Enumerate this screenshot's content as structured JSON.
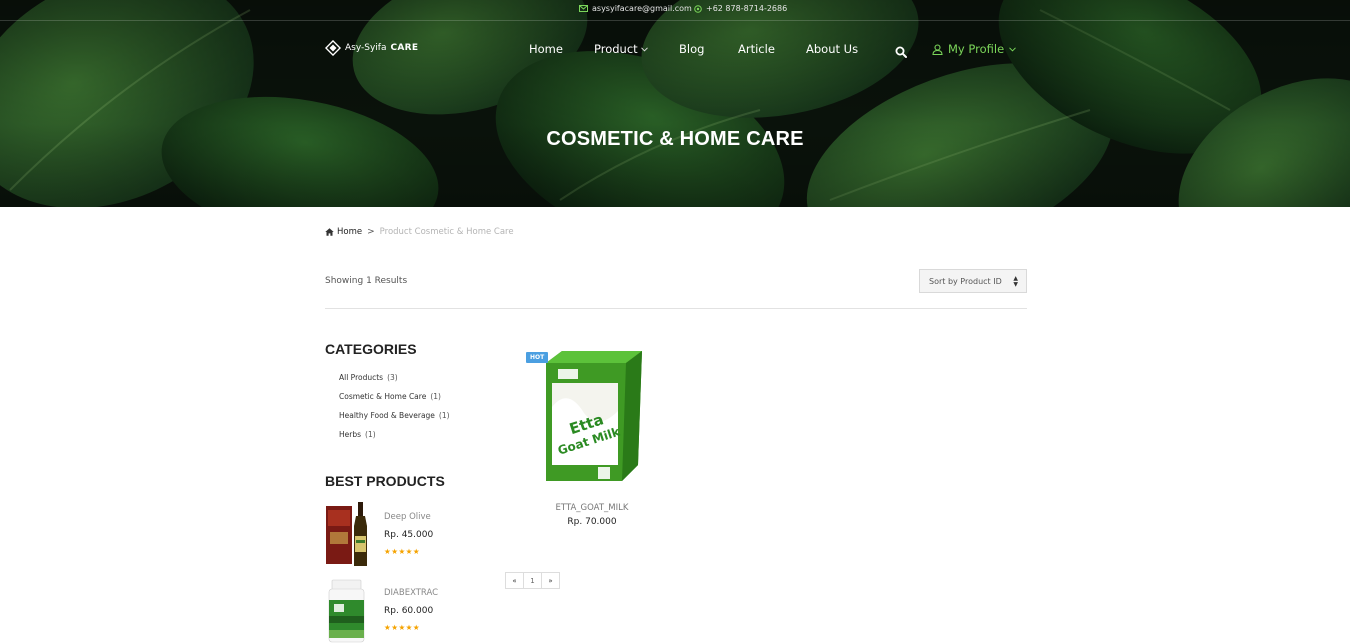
{
  "topbar": {
    "email": "asysyifacare@gmail.com",
    "phone": "+62 878-8714-2686"
  },
  "brand": {
    "logo_text_light": "Asy-Syifa",
    "logo_text_bold": "CARE"
  },
  "nav": {
    "items": [
      {
        "label": "Home"
      },
      {
        "label": "Product"
      },
      {
        "label": "Blog"
      },
      {
        "label": "Article"
      },
      {
        "label": "About Us"
      }
    ],
    "profile_label": "My Profile"
  },
  "hero": {
    "title": "COSMETIC & HOME CARE"
  },
  "breadcrumb": {
    "home": "Home",
    "separator": ">",
    "current": "Product Cosmetic & Home Care"
  },
  "results": {
    "showing": "Showing 1 Results",
    "sort_selected": "Sort by Product ID"
  },
  "sidebar": {
    "categories_title": "CATEGORIES",
    "categories": [
      {
        "name": "All Products",
        "count": "(3)"
      },
      {
        "name": "Cosmetic & Home Care",
        "count": "(1)"
      },
      {
        "name": "Healthy Food & Beverage",
        "count": "(1)"
      },
      {
        "name": "Herbs",
        "count": "(1)"
      }
    ],
    "best_title": "BEST PRODUCTS",
    "best_products": [
      {
        "name": "Deep Olive",
        "price": "Rp. 45.000",
        "rating": 5,
        "stars": "★★★★★"
      },
      {
        "name": "DIABEXTRAC",
        "price": "Rp. 60.000",
        "rating": 5,
        "stars": "★★★★★"
      }
    ]
  },
  "products": [
    {
      "badge": "HOT",
      "name": "ETTA_GOAT_MILK",
      "price": "Rp. 70.000",
      "image_text_1": "Etta",
      "image_text_2": "Goat Milk"
    }
  ],
  "pagination": {
    "prev": "«",
    "pages": [
      "1"
    ],
    "next": "»"
  },
  "colors": {
    "accent_green": "#7bd65a",
    "badge_blue": "#4b9fe1",
    "star_orange": "#f5a300"
  },
  "icons": [
    "envelope-icon",
    "whatsapp-icon",
    "diamond-logo-icon",
    "chevron-down-icon",
    "search-icon",
    "user-icon",
    "home-icon",
    "sort-caret-icon"
  ]
}
